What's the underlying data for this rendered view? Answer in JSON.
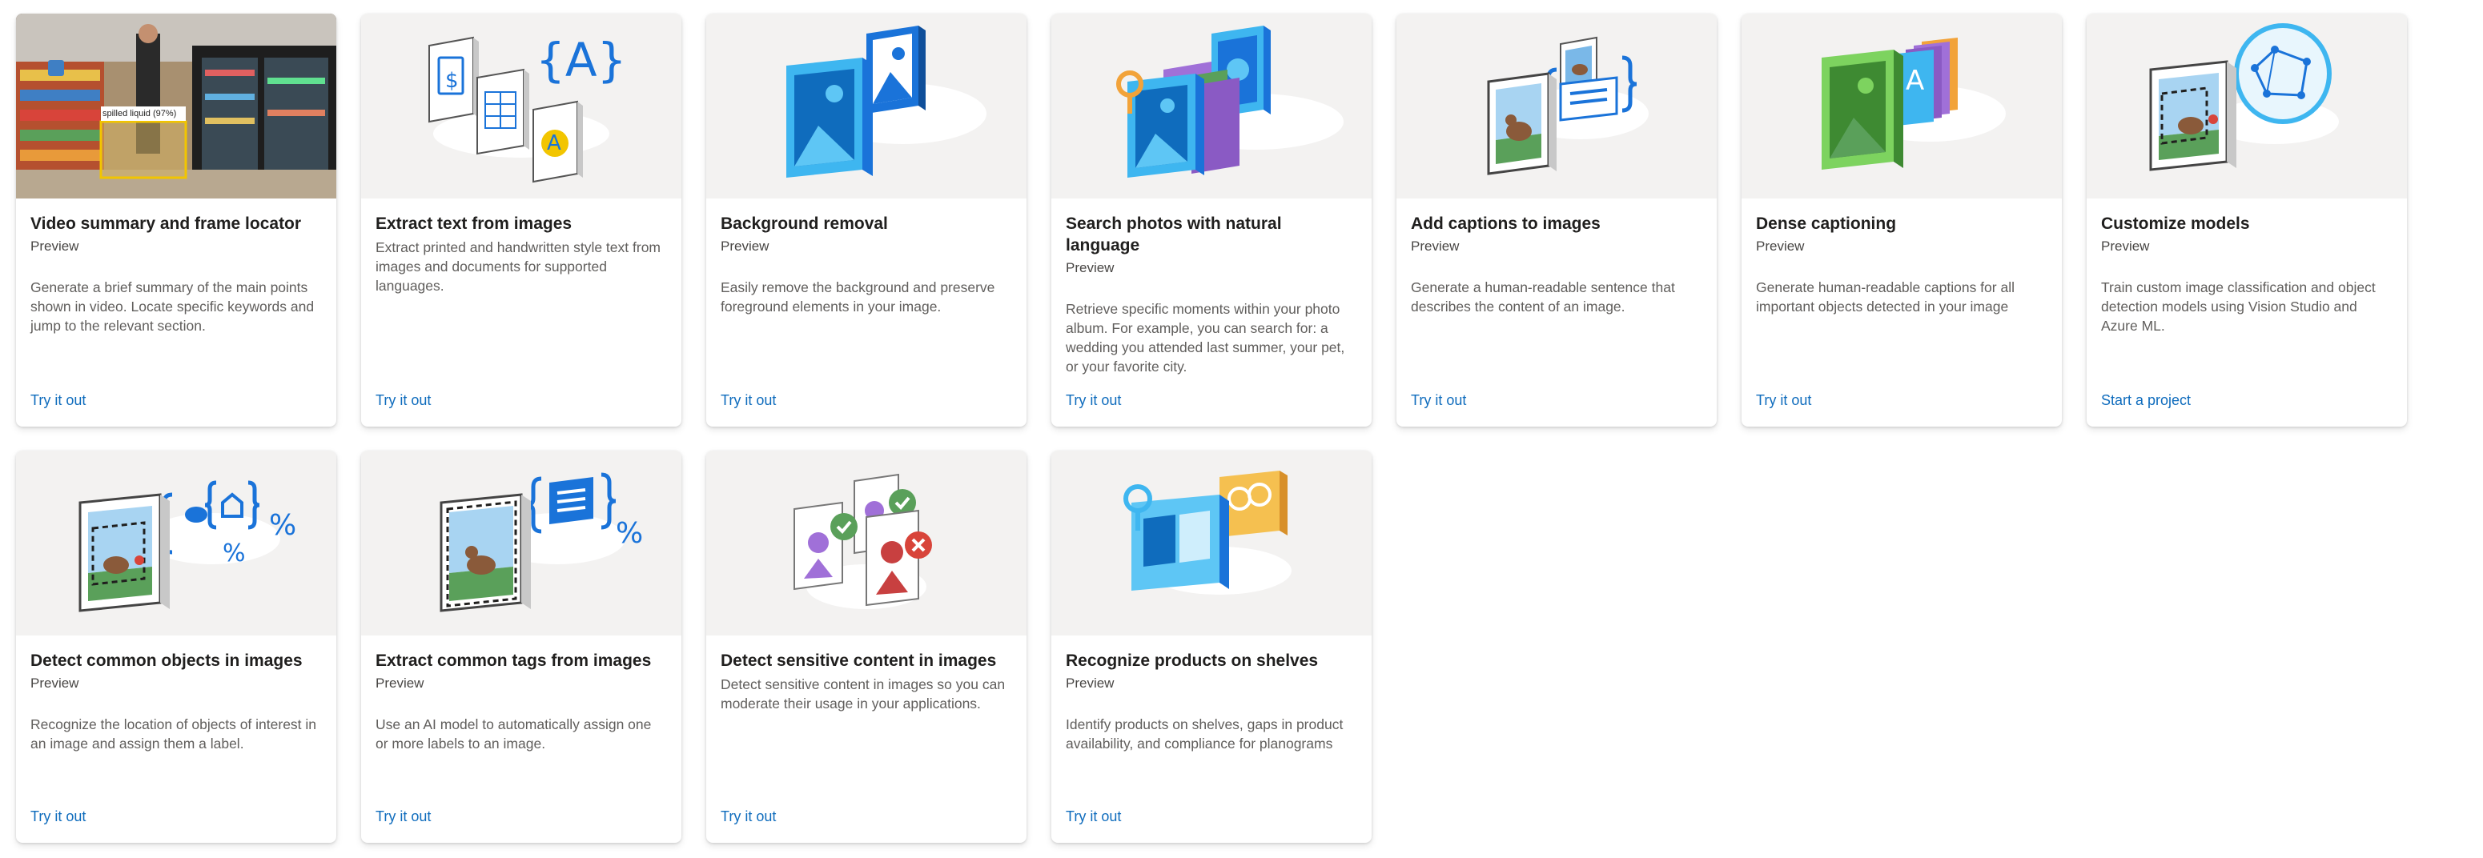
{
  "cards": [
    {
      "title": "Video summary and frame locator",
      "badge": "Preview",
      "description": "Generate a brief summary of the main points shown in video. Locate specific keywords and jump to the relevant section.",
      "link": "Try it out",
      "icon": "video-store-photo",
      "overlay_label": "spilled liquid (97%)"
    },
    {
      "title": "Extract text from images",
      "badge": "",
      "description": "Extract printed and handwritten style text from images and documents for supported languages.",
      "link": "Try it out",
      "icon": "ocr-documents-icon",
      "glyph": "{A}",
      "glyph_small": "A",
      "glyph_dollar": "$"
    },
    {
      "title": "Background removal",
      "badge": "Preview",
      "description": "Easily remove the background and preserve foreground elements in your image.",
      "link": "Try it out",
      "icon": "background-removal-icon"
    },
    {
      "title": "Search photos with natural language",
      "badge": "Preview",
      "description": "Retrieve specific moments within your photo album. For example, you can search for: a wedding you attended last summer, your pet, or your favorite city.",
      "link": "Try it out",
      "icon": "photo-search-icon"
    },
    {
      "title": "Add captions to images",
      "badge": "Preview",
      "description": "Generate a human-readable sentence that describes the content of an image.",
      "link": "Try it out",
      "icon": "image-caption-icon"
    },
    {
      "title": "Dense captioning",
      "badge": "Preview",
      "description": "Generate human-readable captions for all important objects detected in your image",
      "link": "Try it out",
      "icon": "dense-caption-icon",
      "glyph": "A"
    },
    {
      "title": "Customize models",
      "badge": "Preview",
      "description": "Train custom image classification and object detection models using Vision Studio and Azure ML.",
      "link": "Start a project",
      "icon": "custom-model-icon"
    },
    {
      "title": "Detect common objects in images",
      "badge": "Preview",
      "description": "Recognize the location of objects of interest in an image and assign them a label.",
      "link": "Try it out",
      "icon": "object-detection-icon",
      "glyph": "%"
    },
    {
      "title": "Extract common tags from images",
      "badge": "Preview",
      "description": "Use an AI model to automatically assign one or more labels to an image.",
      "link": "Try it out",
      "icon": "image-tagging-icon",
      "glyph": "%"
    },
    {
      "title": "Detect sensitive content in images",
      "badge": "",
      "description": "Detect sensitive content in images so you can moderate their usage in your applications.",
      "link": "Try it out",
      "icon": "content-moderation-icon"
    },
    {
      "title": "Recognize products on shelves",
      "badge": "Preview",
      "description": "Identify products on shelves, gaps in product availability, and compliance for planograms",
      "link": "Try it out",
      "icon": "product-recognition-icon"
    }
  ]
}
